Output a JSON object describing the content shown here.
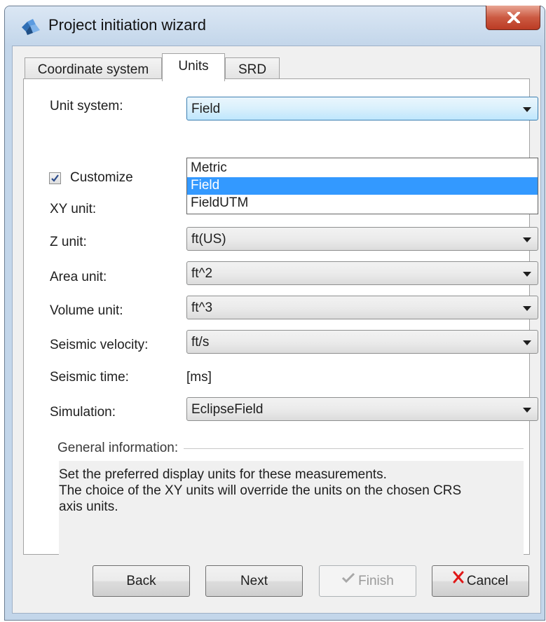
{
  "window": {
    "title": "Project initiation wizard"
  },
  "tabs": [
    {
      "label": "Coordinate system",
      "active": false
    },
    {
      "label": "Units",
      "active": true
    },
    {
      "label": "SRD",
      "active": false
    }
  ],
  "unit_system": {
    "label": "Unit system:",
    "value": "Field",
    "options": [
      "Metric",
      "Field",
      "FieldUTM"
    ],
    "selected_option": "Field"
  },
  "customize": {
    "label": "Customize",
    "checked": true
  },
  "fields": {
    "xy": {
      "label": "XY unit:"
    },
    "z": {
      "label": "Z unit:",
      "value": "ft(US)"
    },
    "area": {
      "label": "Area unit:",
      "value": "ft^2"
    },
    "volume": {
      "label": "Volume unit:",
      "value": "ft^3"
    },
    "seismic_velocity": {
      "label": "Seismic velocity:",
      "value": "ft/s"
    },
    "seismic_time": {
      "label": "Seismic time:",
      "value": "[ms]"
    },
    "simulation": {
      "label": "Simulation:",
      "value": "EclipseField"
    }
  },
  "info": {
    "label": "General information:",
    "lines": [
      "Set the preferred display units for these measurements.",
      "The choice of the XY units will override the units on the chosen CRS",
      "axis units."
    ]
  },
  "buttons": {
    "back": "Back",
    "next": "Next",
    "finish": "Finish",
    "cancel": "Cancel"
  },
  "colors": {
    "selection": "#3399ff",
    "close_button": "#cc5a42",
    "window_frame": "#c3d6ea"
  }
}
